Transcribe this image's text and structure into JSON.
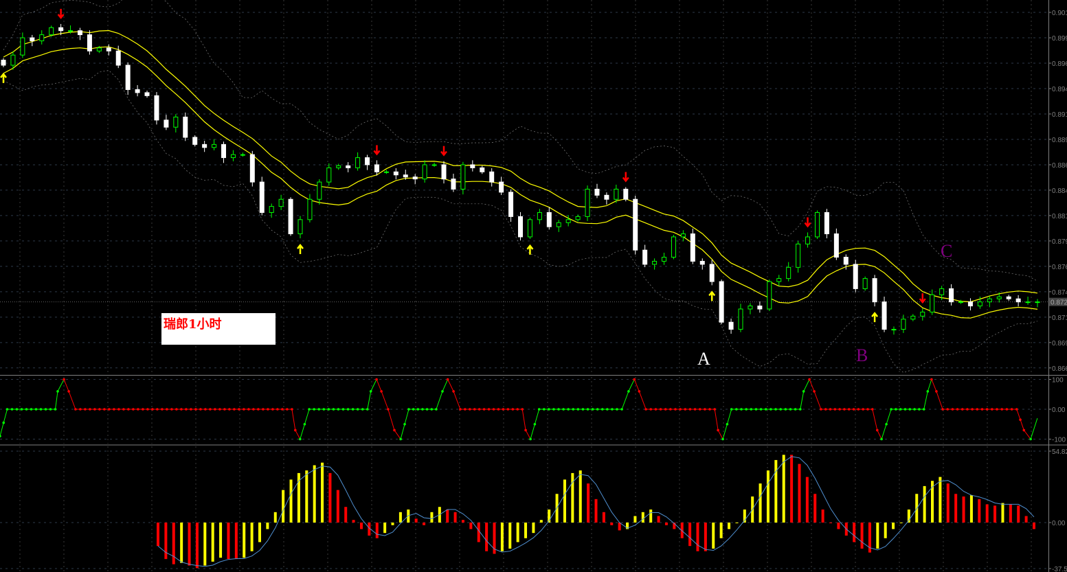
{
  "note": {
    "text": "瑞郎1小时"
  },
  "labels": [
    {
      "text": "A",
      "color": "#ffffff"
    },
    {
      "text": "B",
      "color": "#800080"
    },
    {
      "text": "C",
      "color": "#800080"
    }
  ],
  "colors": {
    "bull": "#00ff00",
    "bear": "#ffffff",
    "ma": "#ffff00",
    "band": "#808080",
    "up_arrow": "#ffff00",
    "down_arrow": "#ff0000",
    "osc_up": "#00ff00",
    "osc_down": "#ff0000",
    "hist_up": "#ffff00",
    "hist_down": "#ff0000",
    "signal": "#4f8fd0",
    "axis": "#808080"
  },
  "chart_data": [
    {
      "type": "candlestick",
      "title": "瑞郎1小时",
      "ylim": [
        0.8652,
        0.9023
      ],
      "y_ticks": [
        "0.901",
        "0.899",
        "0.896",
        "0.894",
        "0.891",
        "0.889",
        "0.886",
        "0.884",
        "0.881",
        "0.879",
        "0.876",
        "0.874",
        "0.871",
        "0.869",
        "0.866"
      ],
      "y_tick_values": [
        0.901,
        0.8985,
        0.896,
        0.8935,
        0.891,
        0.8885,
        0.886,
        0.8835,
        0.881,
        0.8785,
        0.876,
        0.8735,
        0.871,
        0.8685,
        0.866
      ],
      "current_price_label": "0.872",
      "current_price": 0.8725,
      "close": [
        0.8958,
        0.8968,
        0.8985,
        0.8982,
        0.8988,
        0.8995,
        0.8992,
        0.8992,
        0.8988,
        0.8972,
        0.8975,
        0.8972,
        0.8958,
        0.8934,
        0.8931,
        0.8928,
        0.8904,
        0.8897,
        0.8907,
        0.8887,
        0.888,
        0.8877,
        0.888,
        0.8867,
        0.887,
        0.887,
        0.8843,
        0.8813,
        0.8819,
        0.8826,
        0.8792,
        0.8806,
        0.8826,
        0.8843,
        0.8857,
        0.8859,
        0.8857,
        0.8867,
        0.886,
        0.8853,
        0.8853,
        0.885,
        0.8848,
        0.8846,
        0.886,
        0.886,
        0.8846,
        0.8836,
        0.886,
        0.8857,
        0.8853,
        0.8843,
        0.8833,
        0.8809,
        0.8789,
        0.8806,
        0.8813,
        0.8799,
        0.8803,
        0.8806,
        0.8809,
        0.8836,
        0.883,
        0.8826,
        0.8836,
        0.8826,
        0.8776,
        0.8762,
        0.8765,
        0.8769,
        0.8789,
        0.8792,
        0.8765,
        0.8762,
        0.8745,
        0.8705,
        0.8698,
        0.8718,
        0.8721,
        0.8718,
        0.8745,
        0.8748,
        0.8759,
        0.8782,
        0.8789,
        0.8813,
        0.8792,
        0.8769,
        0.8762,
        0.8738,
        0.8748,
        0.8725,
        0.8698,
        0.8698,
        0.8708,
        0.8711,
        0.8715,
        0.8732,
        0.8738,
        0.8725,
        0.8725,
        0.8721,
        0.8725,
        0.8728,
        0.873,
        0.8728,
        0.8725,
        0.8725,
        0.8725
      ],
      "signals": [
        {
          "bar": 6,
          "type": "sell"
        },
        {
          "bar": 39,
          "type": "sell"
        },
        {
          "bar": 46,
          "type": "sell"
        },
        {
          "bar": 65,
          "type": "sell"
        },
        {
          "bar": 84,
          "type": "sell"
        },
        {
          "bar": 96,
          "type": "sell"
        },
        {
          "bar": 0,
          "type": "buy"
        },
        {
          "bar": 31,
          "type": "buy"
        },
        {
          "bar": 55,
          "type": "buy"
        },
        {
          "bar": 74,
          "type": "buy"
        },
        {
          "bar": 91,
          "type": "buy"
        }
      ],
      "annotations": [
        {
          "label": "A",
          "bar": 74
        },
        {
          "label": "B",
          "bar": 89
        },
        {
          "label": "C",
          "bar": 97
        }
      ]
    },
    {
      "type": "line",
      "name": "oscillator",
      "ylim": [
        -100,
        100
      ],
      "y_ticks": [
        "100",
        "0.00",
        "-100"
      ],
      "breakpoints": [
        [
          0,
          -90
        ],
        [
          1.5,
          0
        ],
        [
          11.5,
          0
        ],
        [
          12,
          60
        ],
        [
          13.3,
          100
        ],
        [
          14.3,
          60
        ],
        [
          15.7,
          0
        ],
        [
          60.7,
          0
        ],
        [
          61.4,
          -70
        ],
        [
          62.4,
          -100
        ],
        [
          64.3,
          0
        ],
        [
          76.4,
          0
        ],
        [
          77.1,
          60
        ],
        [
          78.3,
          100
        ],
        [
          79.3,
          60
        ],
        [
          80.7,
          0
        ],
        [
          82,
          -70
        ],
        [
          83.3,
          -100
        ],
        [
          85,
          0
        ],
        [
          90.7,
          0
        ],
        [
          92,
          60
        ],
        [
          93.1,
          100
        ],
        [
          94.3,
          60
        ],
        [
          95.7,
          0
        ],
        [
          108.6,
          0
        ],
        [
          109.3,
          -70
        ],
        [
          110.3,
          -100
        ],
        [
          112.1,
          0
        ],
        [
          129.3,
          0
        ],
        [
          130.7,
          60
        ],
        [
          131.9,
          100
        ],
        [
          132.9,
          60
        ],
        [
          134.3,
          0
        ],
        [
          148.6,
          0
        ],
        [
          149.3,
          -70
        ],
        [
          150.3,
          -100
        ],
        [
          152.1,
          0
        ],
        [
          166.4,
          0
        ],
        [
          167.1,
          60
        ],
        [
          168.3,
          100
        ],
        [
          169.3,
          60
        ],
        [
          170.7,
          0
        ],
        [
          181.4,
          0
        ],
        [
          182.4,
          -70
        ],
        [
          183.3,
          -100
        ],
        [
          185.3,
          0
        ],
        [
          192.1,
          0
        ],
        [
          192.9,
          60
        ],
        [
          193.7,
          100
        ],
        [
          194.7,
          60
        ],
        [
          196,
          0
        ],
        [
          211.4,
          0
        ],
        [
          212.9,
          -70
        ],
        [
          214.3,
          -100
        ],
        [
          215.7,
          -30
        ]
      ]
    },
    {
      "type": "bar",
      "name": "histogram",
      "ylim": [
        -37.5,
        54.82
      ],
      "y_ticks": [
        "54.82",
        "0.00",
        "-37.50"
      ],
      "values": [
        -18,
        -28,
        -32,
        -31,
        -33,
        -35,
        -33,
        -30,
        -27,
        -28,
        -28,
        -27,
        -22,
        -15,
        -5,
        8,
        25,
        33,
        38,
        40,
        44,
        46,
        38,
        25,
        12,
        2,
        -5,
        -10,
        -12,
        -8,
        -2,
        8,
        10,
        3,
        -2,
        8,
        12,
        10,
        8,
        2,
        -5,
        -15,
        -22,
        -24,
        -22,
        -20,
        -15,
        -12,
        -8,
        2,
        10,
        22,
        33,
        38,
        40,
        30,
        18,
        8,
        -2,
        -6,
        -5,
        5,
        8,
        10,
        5,
        -2,
        -5,
        -12,
        -18,
        -22,
        -22,
        -20,
        -12,
        -5,
        0,
        10,
        20,
        30,
        40,
        48,
        52,
        52,
        45,
        35,
        22,
        10,
        0,
        -5,
        -10,
        -15,
        -20,
        -23,
        -20,
        -12,
        -5,
        0,
        10,
        22,
        28,
        32,
        35,
        30,
        22,
        20,
        21,
        18,
        14,
        13,
        15,
        14,
        13,
        5,
        -5
      ]
    }
  ]
}
